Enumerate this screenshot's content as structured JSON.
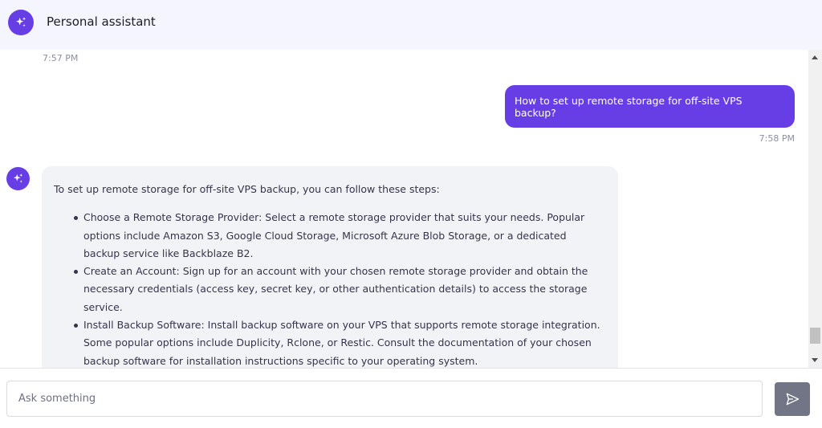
{
  "header": {
    "title": "Personal assistant",
    "avatar_icon": "sparkles-icon",
    "accent_color": "#673de6"
  },
  "chat": {
    "messages": [
      {
        "role": "timestamp",
        "time": "7:57 PM"
      },
      {
        "role": "user",
        "text": "How to set up remote storage for off-site VPS backup?",
        "time": "7:58 PM"
      },
      {
        "role": "assistant",
        "intro": "To set up remote storage for off-site VPS backup, you can follow these steps:",
        "steps": [
          "Choose a Remote Storage Provider: Select a remote storage provider that suits your needs. Popular options include Amazon S3, Google Cloud Storage, Microsoft Azure Blob Storage, or a dedicated backup service like Backblaze B2.",
          "Create an Account: Sign up for an account with your chosen remote storage provider and obtain the necessary credentials (access key, secret key, or other authentication details) to access the storage service.",
          "Install Backup Software: Install backup software on your VPS that supports remote storage integration. Some popular options include Duplicity, Rclone, or Restic. Consult the documentation of your chosen backup software for installation instructions specific to your operating system."
        ]
      }
    ]
  },
  "composer": {
    "placeholder": "Ask something",
    "value": "",
    "send_icon": "send-icon"
  }
}
